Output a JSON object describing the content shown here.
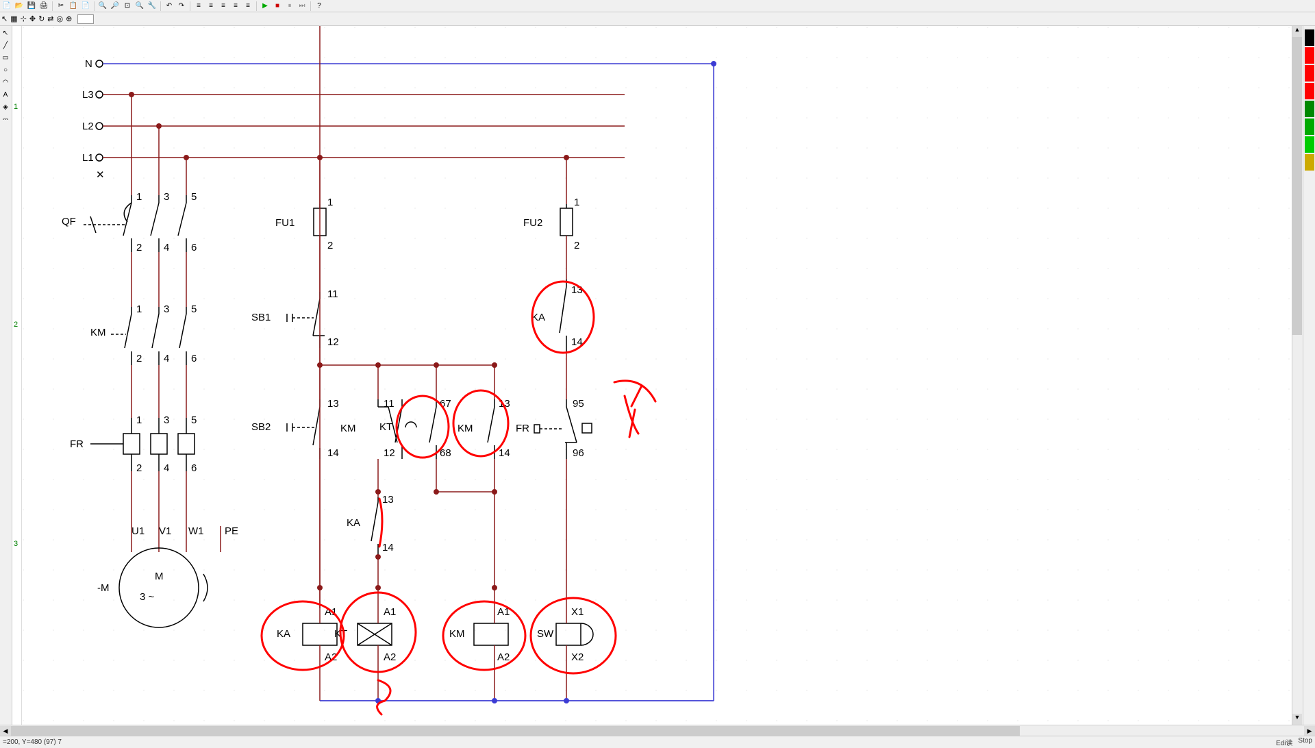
{
  "ruler": {
    "m1": "1",
    "m2": "2",
    "m3": "3"
  },
  "labels": {
    "N": "N",
    "L3": "L3",
    "L2": "L2",
    "L1": "L1",
    "QF": "QF",
    "KM": "KM",
    "FR": "FR",
    "M": "M",
    "Mline2": "3   ~",
    "minusM": "-M",
    "U1": "U1",
    "V1": "V1",
    "W1": "W1",
    "PE": "PE",
    "FU1": "FU1",
    "FU2": "FU2",
    "SB1": "SB1",
    "SB2": "SB2",
    "KT": "KT",
    "KA": "KA",
    "SW": "SW",
    "n1": "1",
    "n2": "2",
    "n3": "3",
    "n4": "4",
    "n5": "5",
    "n6": "6",
    "n11": "11",
    "n12": "12",
    "n13": "13",
    "n14": "14",
    "n67": "67",
    "n68": "68",
    "n95": "95",
    "n96": "96",
    "A1": "A1",
    "A2": "A2",
    "X1": "X1",
    "X2": "X2"
  },
  "status": {
    "left": "=200, Y=480 (97) 7",
    "edi": "Edi读",
    "stop": "Stop"
  },
  "colors": {
    "wire": "#8b1a1a",
    "neutral": "#3c3cd4",
    "ann": "#ff0000"
  },
  "palette": [
    "#000000",
    "#ff0000",
    "#ff0000",
    "#ff0000",
    "#008000",
    "#008000",
    "#00a000",
    "#d4aa00"
  ]
}
